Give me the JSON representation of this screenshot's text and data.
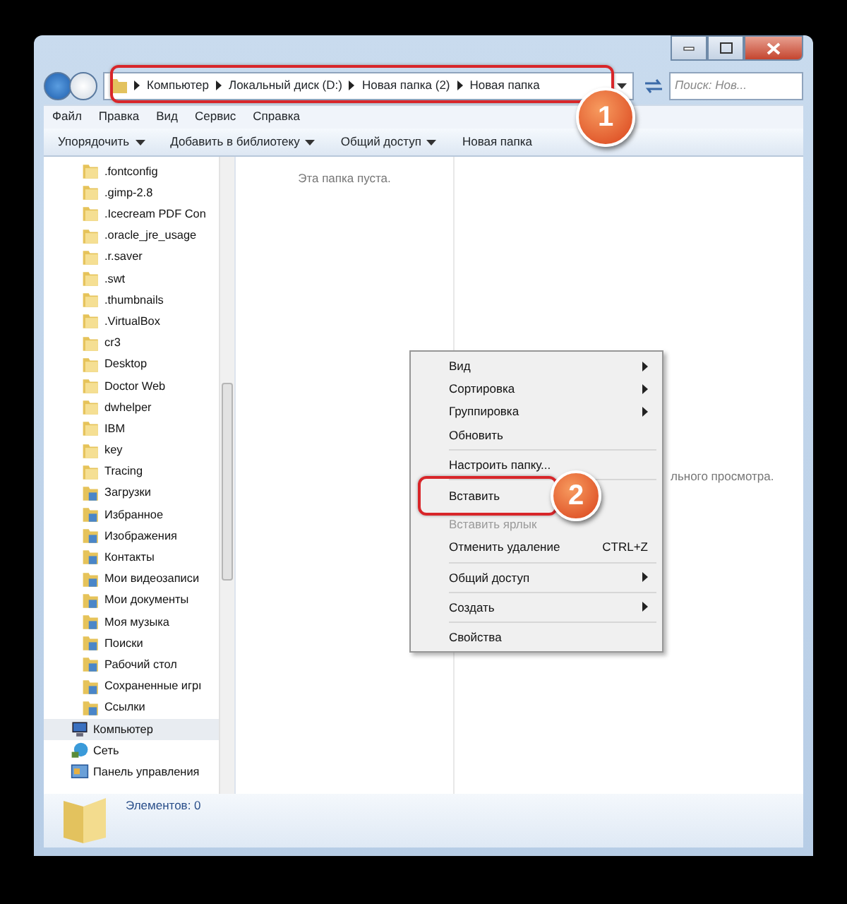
{
  "address": {
    "crumbs": [
      "Компьютер",
      "Локальный диск (D:)",
      "Новая папка (2)",
      "Новая папка"
    ],
    "callout": "1",
    "search_placeholder": "Поиск: Нов..."
  },
  "menu_bar": [
    "Файл",
    "Правка",
    "Вид",
    "Сервис",
    "Справка"
  ],
  "toolbar": [
    {
      "label": "Упорядочить",
      "dropdown": true
    },
    {
      "label": "Добавить в библиотеку",
      "dropdown": true
    },
    {
      "label": "Общий доступ",
      "dropdown": true
    },
    {
      "label": "Новая папка",
      "dropdown": false
    }
  ],
  "nav_tree": [
    {
      "children": [
        {
          "label": ".fontconfig",
          "kind": "folder",
          "selected": false
        },
        {
          "label": ".gimp-2.8",
          "kind": "folder",
          "selected": false
        },
        {
          "label": ".Icecream PDF Con",
          "kind": "folder",
          "selected": false
        },
        {
          "label": ".oracle_jre_usage",
          "kind": "folder",
          "selected": false
        },
        {
          "label": ".r.saver",
          "kind": "folder",
          "selected": false
        },
        {
          "label": ".swt",
          "kind": "folder",
          "selected": false
        },
        {
          "label": ".thumbnails",
          "kind": "folder",
          "selected": false
        },
        {
          "label": ".VirtualBox",
          "kind": "folder",
          "selected": false
        },
        {
          "label": "cr3",
          "kind": "folder",
          "selected": false
        },
        {
          "label": "Desktop",
          "kind": "folder",
          "selected": false
        },
        {
          "label": "Doctor Web",
          "kind": "folder",
          "selected": false
        },
        {
          "label": "dwhelper",
          "kind": "folder",
          "selected": false
        },
        {
          "label": "IBM",
          "kind": "folder",
          "selected": false
        },
        {
          "label": "key",
          "kind": "folder",
          "selected": false
        },
        {
          "label": "Tracing",
          "kind": "folder",
          "selected": false
        },
        {
          "label": "Загрузки",
          "kind": "special",
          "selected": false
        },
        {
          "label": "Избранное",
          "kind": "special",
          "selected": false
        },
        {
          "label": "Изображения",
          "kind": "special",
          "selected": false
        },
        {
          "label": "Контакты",
          "kind": "special",
          "selected": false
        },
        {
          "label": "Мои видеозаписи",
          "kind": "special",
          "selected": false
        },
        {
          "label": "Мои документы",
          "kind": "special",
          "selected": false
        },
        {
          "label": "Моя музыка",
          "kind": "special",
          "selected": false
        },
        {
          "label": "Поиски",
          "kind": "special",
          "selected": false
        },
        {
          "label": "Рабочий стол",
          "kind": "special",
          "selected": false
        },
        {
          "label": "Сохраненные игрı",
          "kind": "special",
          "selected": false
        },
        {
          "label": "Ссылки",
          "kind": "special",
          "selected": false
        }
      ]
    },
    {
      "label": "Компьютер",
      "kind": "computer",
      "selected": true
    },
    {
      "label": "Сеть",
      "kind": "network",
      "selected": false
    },
    {
      "label": "Панель управления",
      "kind": "control-panel",
      "selected": false
    }
  ],
  "content": {
    "empty_text": "Эта папка пуста."
  },
  "preview": {
    "text": "льного просмотра."
  },
  "context_menu": [
    {
      "kind": "item",
      "label": "Вид",
      "submenu": true,
      "disabled": false
    },
    {
      "kind": "item",
      "label": "Сортировка",
      "submenu": true,
      "disabled": false
    },
    {
      "kind": "item",
      "label": "Группировка",
      "submenu": true,
      "disabled": false
    },
    {
      "kind": "item",
      "label": "Обновить",
      "submenu": false,
      "disabled": false
    },
    {
      "kind": "separator"
    },
    {
      "kind": "item",
      "label": "Настроить папку...",
      "submenu": false,
      "disabled": false
    },
    {
      "kind": "separator"
    },
    {
      "kind": "item",
      "label": "Вставить",
      "submenu": false,
      "disabled": false,
      "callout": "2"
    },
    {
      "kind": "item",
      "label": "Вставить ярлык",
      "submenu": false,
      "disabled": true
    },
    {
      "kind": "item",
      "label": "Отменить удаление",
      "shortcut": "CTRL+Z",
      "submenu": false,
      "disabled": false
    },
    {
      "kind": "separator"
    },
    {
      "kind": "item",
      "label": "Общий доступ",
      "submenu": true,
      "disabled": false
    },
    {
      "kind": "separator"
    },
    {
      "kind": "item",
      "label": "Создать",
      "submenu": true,
      "disabled": false
    },
    {
      "kind": "separator"
    },
    {
      "kind": "item",
      "label": "Свойства",
      "submenu": false,
      "disabled": false
    }
  ],
  "status_bar": {
    "text": "Элементов: 0"
  }
}
